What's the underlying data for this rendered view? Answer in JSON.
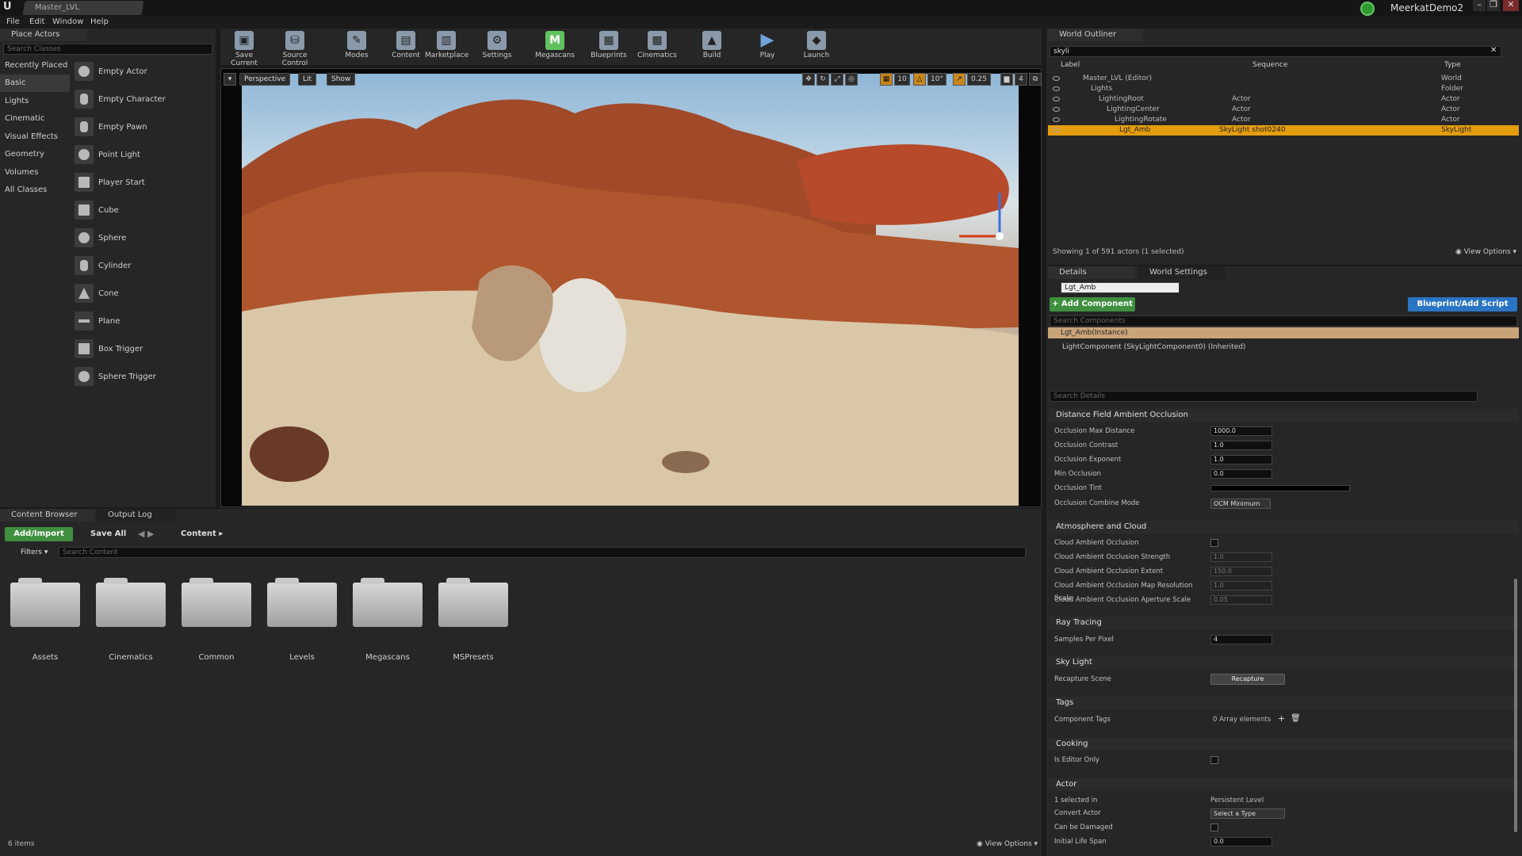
{
  "app": {
    "document_tab": "Master_LVL",
    "project_name": "MeerkatDemo2",
    "window_buttons": [
      "–",
      "❐",
      "✕"
    ]
  },
  "menu": [
    "File",
    "Edit",
    "Window",
    "Help"
  ],
  "place_actors": {
    "tab_label": "Place Actors",
    "search_placeholder": "Search Classes",
    "categories": [
      "Recently Placed",
      "Basic",
      "Lights",
      "Cinematic",
      "Visual Effects",
      "Geometry",
      "Volumes",
      "All Classes"
    ],
    "active_category": "Basic",
    "actors": [
      "Empty Actor",
      "Empty Character",
      "Empty Pawn",
      "Point Light",
      "Player Start",
      "Cube",
      "Sphere",
      "Cylinder",
      "Cone",
      "Plane",
      "Box Trigger",
      "Sphere Trigger"
    ]
  },
  "toolbar": {
    "items": [
      "Save Current",
      "Source Control",
      "Modes",
      "Content",
      "Marketplace",
      "Settings",
      "Megascans",
      "Blueprints",
      "Cinematics",
      "Build",
      "Play",
      "Launch"
    ]
  },
  "viewport": {
    "perspective": "Perspective",
    "lit": "Lit",
    "show": "Show",
    "grid_snap": "10",
    "rot_snap": "10°",
    "scale_snap": "0.25",
    "camera_speed": "4"
  },
  "content_browser": {
    "tab_label": "Content Browser",
    "output_tab": "Output Log",
    "add_import": "Add/Import",
    "save_all": "Save All",
    "path": "Content",
    "filters": "Filters",
    "search_placeholder": "Search Content",
    "folders": [
      "Assets",
      "Cinematics",
      "Common",
      "Levels",
      "Megascans",
      "MSPresets"
    ],
    "item_count": "6 items",
    "view_options": "View Options"
  },
  "outliner": {
    "tab_label": "World Outliner",
    "search_value": "skyli",
    "col_label": "Label",
    "col_sequence": "Sequence",
    "col_type": "Type",
    "rows": [
      {
        "label": "Master_LVL (Editor)",
        "sequence": "",
        "type": "World"
      },
      {
        "label": "Lights",
        "sequence": "",
        "type": "Folder"
      },
      {
        "label": "LightingRoot",
        "sequence": "Actor",
        "type": "Actor"
      },
      {
        "label": "LightingCenter",
        "sequence": "Actor",
        "type": "Actor"
      },
      {
        "label": "LightingRotate",
        "sequence": "Actor",
        "type": "Actor"
      },
      {
        "label": "Lgt_Amb",
        "sequence": "SkyLight shot0240",
        "type": "SkyLight"
      }
    ],
    "status": "Showing 1 of 591 actors (1 selected)",
    "view_options": "View Options"
  },
  "details": {
    "tab_label": "Details",
    "world_settings_tab": "World Settings",
    "name_value": "Lgt_Amb",
    "add_component": "+ Add Component",
    "blueprint_button": "Blueprint/Add Script",
    "search_components": "Search Components",
    "instance_label": "Lgt_Amb(Instance)",
    "component_label": "LightComponent (SkyLightComponent0) (Inherited)",
    "search_details": "Search Details",
    "sections": {
      "dfao": {
        "title": "Distance Field Ambient Occlusion",
        "max_distance_label": "Occlusion Max Distance",
        "max_distance": "1000.0",
        "contrast_label": "Occlusion Contrast",
        "contrast": "1.0",
        "exponent_label": "Occlusion Exponent",
        "exponent": "1.0",
        "min_label": "Min Occlusion",
        "min": "0.0",
        "tint_label": "Occlusion Tint",
        "combine_label": "Occlusion Combine Mode",
        "combine": "OCM Minimum"
      },
      "atmosphere": {
        "title": "Atmosphere and Cloud",
        "cloud_ao_label": "Cloud Ambient Occlusion",
        "strength_label": "Cloud Ambient Occlusion Strength",
        "strength": "1.0",
        "extent_label": "Cloud Ambient Occlusion Extent",
        "extent": "150.0",
        "res_label": "Cloud Ambient Occlusion Map Resolution Scale",
        "res": "1.0",
        "aperture_label": "Cloud Ambient Occlusion Aperture Scale",
        "aperture": "0.05"
      },
      "ray_tracing": {
        "title": "Ray Tracing",
        "spp_label": "Samples Per Pixel",
        "spp": "4"
      },
      "sky_light": {
        "title": "Sky Light",
        "recapture_label": "Recapture Scene",
        "recapture_button": "Recapture"
      },
      "tags": {
        "title": "Tags",
        "component_tags_label": "Component Tags",
        "array_elements": "0 Array elements"
      },
      "cooking": {
        "title": "Cooking",
        "editor_only_label": "Is Editor Only"
      },
      "actor": {
        "title": "Actor",
        "selected_in_label": "1 selected in",
        "selected_in": "Persistent Level",
        "convert_label": "Convert Actor",
        "convert": "Select a Type",
        "damaged_label": "Can be Damaged",
        "lifespan_label": "Initial Life Span",
        "lifespan": "0.0"
      }
    }
  },
  "colors": {
    "selection": "#e49d0c",
    "add_component": "#3f8f3f",
    "blueprint": "#2a74c4",
    "megascans": "#5fc25f"
  }
}
